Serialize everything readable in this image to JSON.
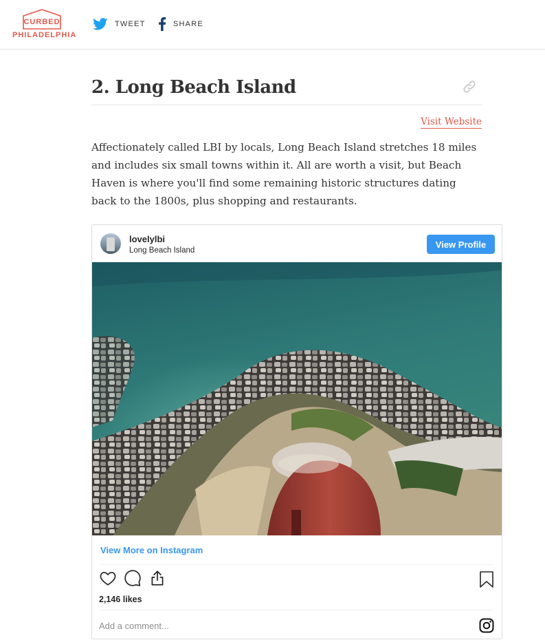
{
  "header": {
    "logo_brand": "CURBED",
    "logo_city": "PHILADELPHIA",
    "tweet_label": "TWEET",
    "share_label": "SHARE"
  },
  "section": {
    "title": "2. Long Beach Island",
    "visit_link": "Visit Website",
    "body": "Affectionately called LBI by locals, Long Beach Island stretches 18 miles and includes six small towns within it. All are worth a visit, but Beach Haven is where you'll find some remaining historic structures dating back to the 1800s, plus shopping and restaurants."
  },
  "instagram": {
    "username": "lovelylbi",
    "location": "Long Beach Island",
    "view_profile_label": "View Profile",
    "view_more_label": "View More on Instagram",
    "likes": "2,146 likes",
    "comment_placeholder": "Add a comment..."
  },
  "colors": {
    "brand": "#e6584a",
    "twitter": "#1da1f2",
    "instagram_blue": "#3897f0"
  },
  "icons": [
    "twitter-icon",
    "facebook-icon",
    "link-icon",
    "heart-icon",
    "comment-icon",
    "share-icon",
    "bookmark-icon",
    "instagram-icon"
  ]
}
